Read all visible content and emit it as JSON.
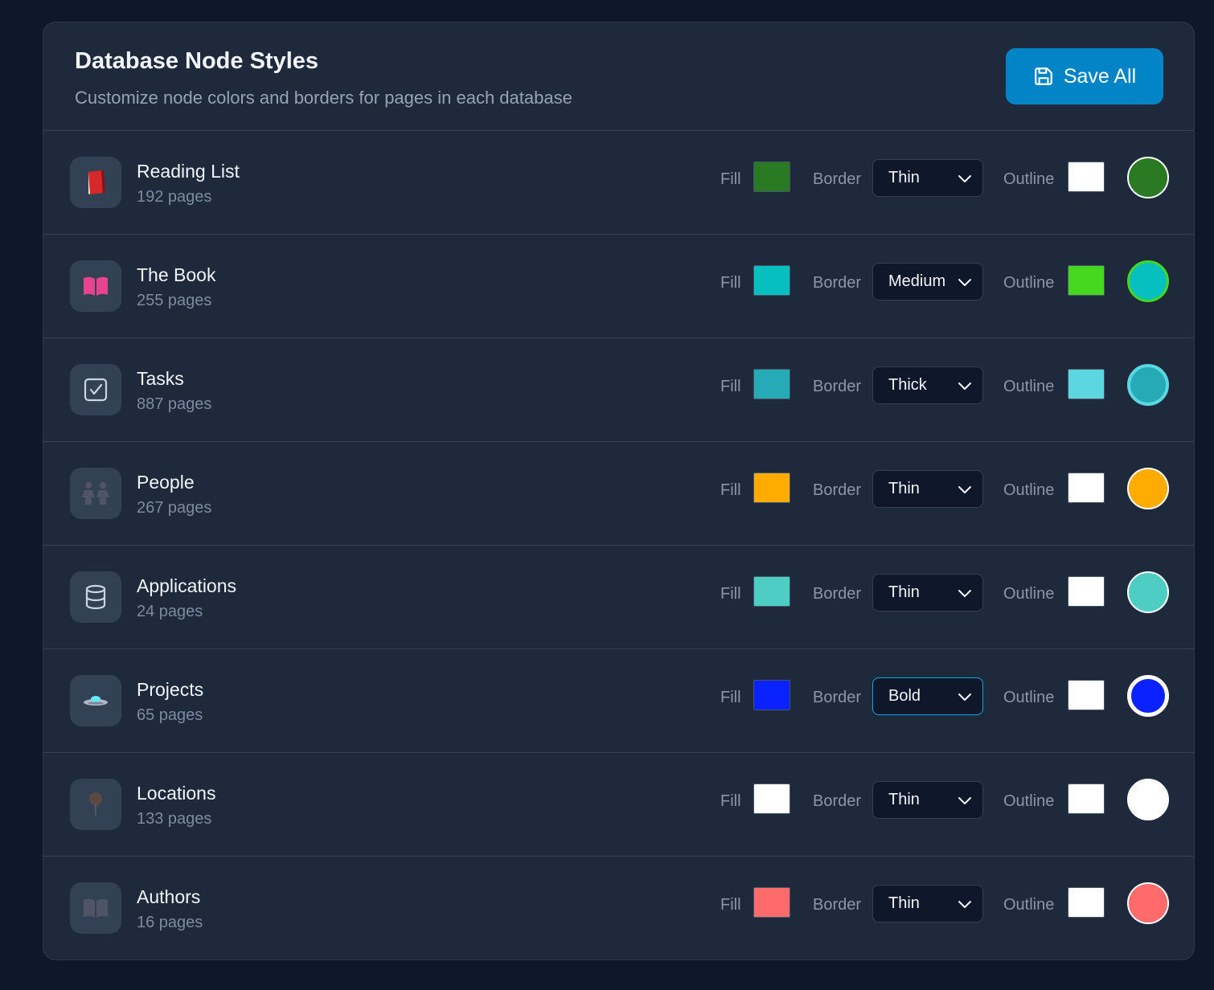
{
  "header": {
    "title": "Database Node Styles",
    "subtitle": "Customize node colors and borders for pages in each database",
    "save_label": "Save All",
    "save_icon": "save-icon"
  },
  "labels": {
    "fill": "Fill",
    "border": "Border",
    "outline": "Outline"
  },
  "databases": [
    {
      "name": "Reading List",
      "count": "192 pages",
      "icon": "red-book-icon",
      "fill": "#2a7a23",
      "border": "Thin",
      "outline": "#ffffff",
      "preview_border_color": "#ffffff"
    },
    {
      "name": "The Book",
      "count": "255 pages",
      "icon": "open-book-icon",
      "fill": "#08bfbf",
      "border": "Medium",
      "outline": "#46d81e",
      "preview_border_color": "#46d81e"
    },
    {
      "name": "Tasks",
      "count": "887 pages",
      "icon": "checkbox-icon",
      "fill": "#26aab5",
      "border": "Thick",
      "outline": "#5cd6e0",
      "preview_border_color": "#5cd6e0"
    },
    {
      "name": "People",
      "count": "267 pages",
      "icon": "people-icon",
      "fill": "#ffab00",
      "border": "Thin",
      "outline": "#ffffff",
      "preview_border_color": "#ffffff"
    },
    {
      "name": "Applications",
      "count": "24 pages",
      "icon": "database-icon",
      "fill": "#4ecdc4",
      "border": "Thin",
      "outline": "#ffffff",
      "preview_border_color": "#ffffff"
    },
    {
      "name": "Projects",
      "count": "65 pages",
      "icon": "ufo-icon",
      "fill": "#0a22ff",
      "border": "Bold",
      "outline": "#ffffff",
      "preview_border_color": "#ffffff"
    },
    {
      "name": "Locations",
      "count": "133 pages",
      "icon": "pin-icon",
      "fill": "#ffffff",
      "border": "Thin",
      "outline": "#ffffff",
      "preview_border_color": "#ffffff"
    },
    {
      "name": "Authors",
      "count": "16 pages",
      "icon": "book-icon",
      "fill": "#ff6b6b",
      "border": "Thin",
      "outline": "#ffffff",
      "preview_border_color": "#ffffff"
    }
  ]
}
